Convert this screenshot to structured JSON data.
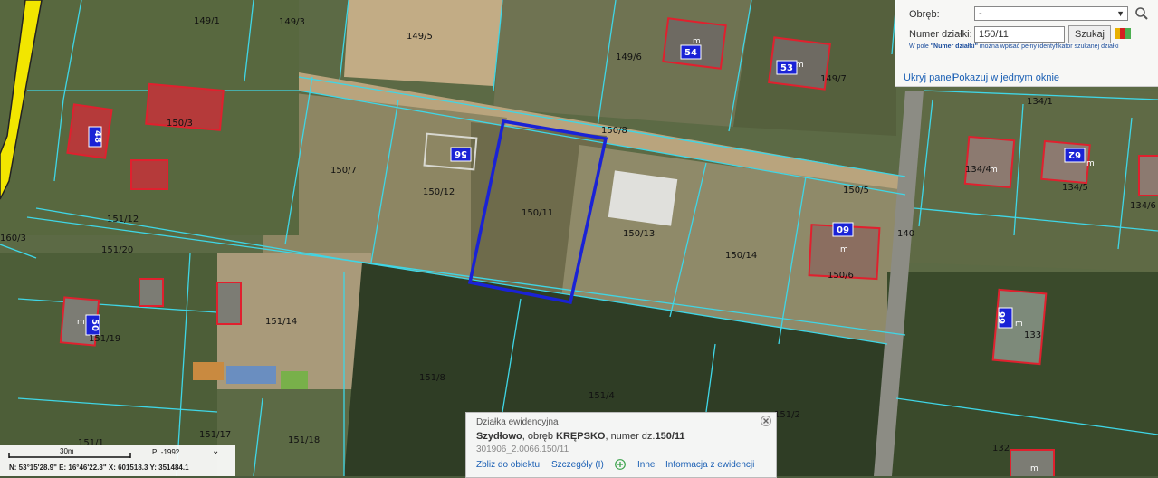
{
  "search_panel": {
    "obreb_label": "Obręb:",
    "obreb_value": "-",
    "parcel_label": "Numer działki:",
    "parcel_value": "150/11",
    "search_button": "Szukaj",
    "hint_prefix": "W pole ",
    "hint_bold": "\"Numer działki\"",
    "hint_suffix": " można wpisać pełny identyfikator szukanej działki",
    "hide_panel": "Ukryj panel",
    "show_one_window": "Pokazuj w jednym oknie",
    "swatch_colors": [
      "#e8b000",
      "#d42020",
      "#4caf50"
    ]
  },
  "map": {
    "colors": {
      "selected_parcel": "#1a22d6",
      "parcel_line": "#3fd6e6",
      "building_outline": "#e0202e",
      "road": "#f2e600"
    },
    "parcel_labels": [
      "149/1",
      "149/3",
      "149/5",
      "149/6",
      "149/7",
      "134/1",
      "150/3",
      "150/8",
      "150/7",
      "150/12",
      "150/11",
      "150/13",
      "150/14",
      "150/5",
      "150/6",
      "134/4",
      "134/5",
      "134/6",
      "151/12",
      "151/20",
      "160/3",
      "151/14",
      "151/19",
      "151/8",
      "151/4",
      "151/2",
      "133",
      "140",
      "151/17",
      "151/18",
      "151/1",
      "132"
    ],
    "building_numbers": [
      "54",
      "53",
      "48",
      "56",
      "60",
      "62",
      "66",
      "50"
    ],
    "building_marker": "m"
  },
  "info_popup": {
    "title": "Działka ewidencyjna",
    "locality": "Szydłowo",
    "obreb_text": ", obręb ",
    "obreb_name": "KRĘPSKO",
    "number_text": ", numer dz.",
    "parcel_number": "150/11",
    "identifier": "301906_2.0066.150/11",
    "links": [
      "Zbliż do obiektu",
      "Szczegóły (I)",
      "Inne",
      "Informacja z ewidencji"
    ]
  },
  "status_bar": {
    "scale_label": "30m",
    "crs": "PL-1992",
    "coords": "N: 53°15'28.9\"  E: 16°46'22.3\"  X: 601518.3  Y: 351484.1"
  }
}
